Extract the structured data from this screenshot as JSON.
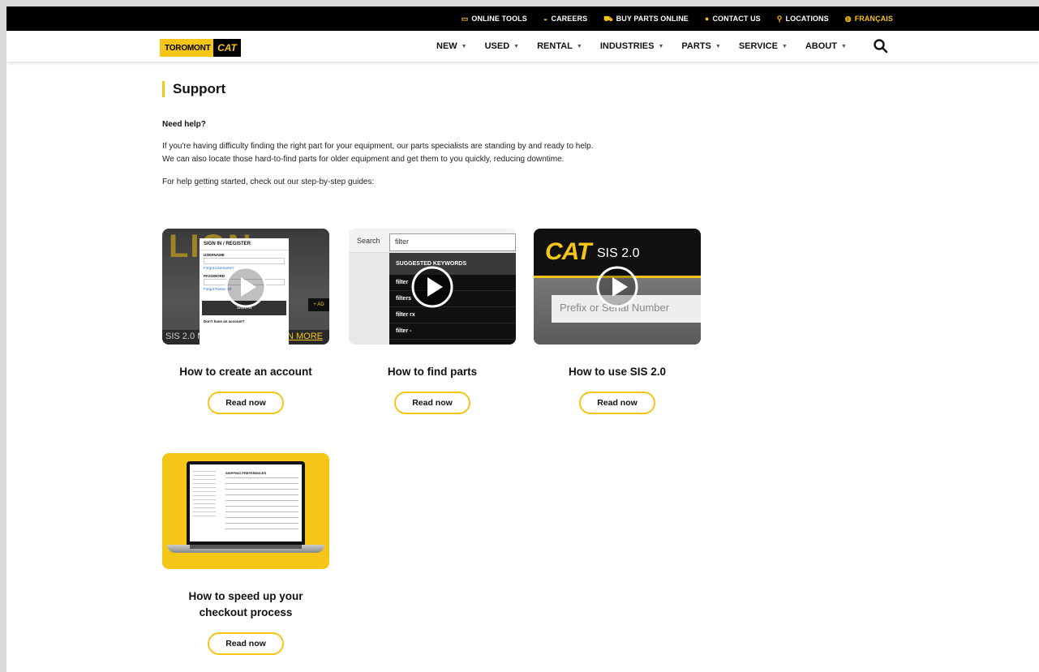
{
  "utility_links": [
    {
      "icon": "laptop-icon",
      "glyph": "▭",
      "label": "ONLINE TOOLS"
    },
    {
      "icon": "helmet-icon",
      "glyph": "◒",
      "label": "CAREERS"
    },
    {
      "icon": "cart-icon",
      "glyph": "⛟",
      "label": "BUY PARTS ONLINE"
    },
    {
      "icon": "chat-icon",
      "glyph": "●",
      "label": "CONTACT US"
    },
    {
      "icon": "pin-icon",
      "glyph": "⚲",
      "label": "LOCATIONS"
    },
    {
      "icon": "globe-icon",
      "glyph": "◍",
      "label": "FRANÇAIS"
    }
  ],
  "logo": {
    "left": "TOROMONT",
    "right": "CAT"
  },
  "nav": [
    "NEW",
    "USED",
    "RENTAL",
    "INDUSTRIES",
    "PARTS",
    "SERVICE",
    "ABOUT"
  ],
  "page": {
    "title": "Support",
    "need_help": "Need help?",
    "para_line1": "If you're having difficulty finding the right part for your equipment, our parts specialists are standing by and ready to help.",
    "para_line2": "We can also locate those hard-to-find parts for older equipment and get them to you quickly, reducing downtime.",
    "para2": "For help getting started, check out our step-by-step guides:"
  },
  "guides": [
    {
      "title_line1": "How to create an account",
      "title_line2": "",
      "button": "Read now"
    },
    {
      "title_line1": "How to find parts",
      "title_line2": "",
      "button": "Read now"
    },
    {
      "title_line1": "How to use SIS 2.0",
      "title_line2": "",
      "button": "Read now"
    },
    {
      "title_line1": "How to speed up your",
      "title_line2": "checkout process",
      "button": "Read now"
    }
  ],
  "thumb1": {
    "bg_text": "LION",
    "modal_title": "SIGN IN / REGISTER",
    "username": "USERNAME",
    "forgot_user": "Forgot Username?",
    "password": "PASSWORD",
    "forgot_pass": "Forgot Password",
    "sign_in": "SIGN IN",
    "no_account": "Don't have an account?",
    "bottom_left": "SIS 2.0 M",
    "bottom_right": "N MORE",
    "add": "+ AD"
  },
  "thumb2": {
    "search_label": "Search",
    "input_value": "filter",
    "header": "SUGGESTED KEYWORDS",
    "items": [
      "filter",
      "filters",
      "filter rx",
      "filter -"
    ]
  },
  "thumb3": {
    "logo": "CAT",
    "title": "SIS 2.0",
    "field": "Prefix or Serial Number"
  },
  "thumb4": {
    "screen_title": "SHIPPING PREFERENCES"
  },
  "colors": {
    "accent": "#f5c518",
    "black": "#000000"
  }
}
